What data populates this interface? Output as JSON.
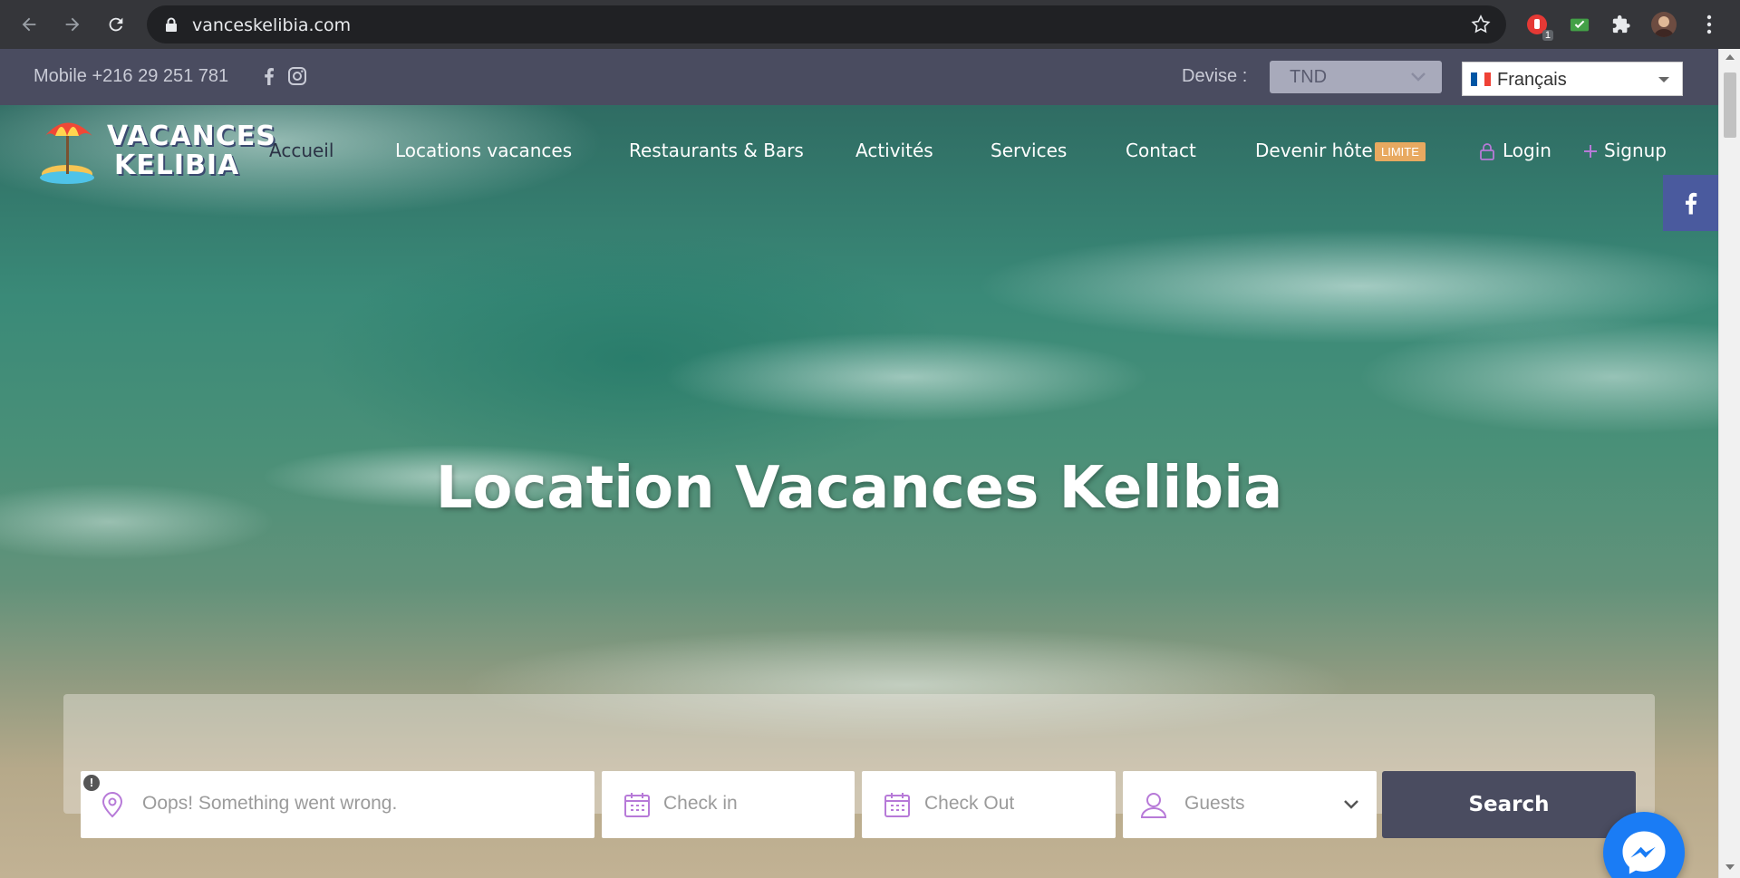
{
  "browser": {
    "url": "vanceskelibia.com",
    "extension_badge": "1"
  },
  "topbar": {
    "mobile": "Mobile +216 29 251 781",
    "devise_label": "Devise :",
    "currency": "TND",
    "language": "Français"
  },
  "nav": {
    "items": [
      "Accueil",
      "Locations vacances",
      "Restaurants & Bars",
      "Activités",
      "Services",
      "Contact",
      "Devenir hôte"
    ],
    "badge": "LIMITE",
    "login": "Login",
    "signup": "Signup"
  },
  "logo": {
    "line1": "VACANCES",
    "line2": "KELIBIA"
  },
  "hero": {
    "title": "Location Vacances Kelibia"
  },
  "search": {
    "location_placeholder": "Oops! Something went wrong.",
    "warning": "!",
    "checkin_placeholder": "Check in",
    "checkout_placeholder": "Check Out",
    "guests_placeholder": "Guests",
    "button": "Search"
  },
  "colors": {
    "topbar": "#4a4c60",
    "badge": "#e8a960",
    "icon_accent": "#b77ad8",
    "facebook": "#4a5a9e",
    "messenger": "#1a7cf5"
  }
}
